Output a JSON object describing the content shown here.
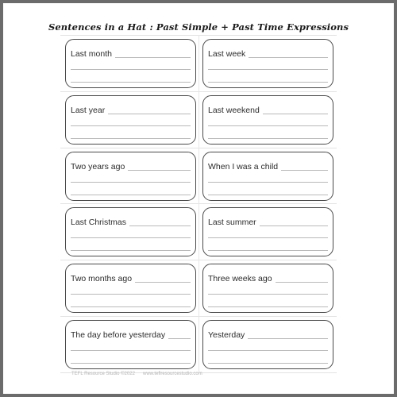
{
  "worksheet": {
    "title": "Sentences in a Hat : Past Simple + Past Time Expressions",
    "cards": [
      {
        "label": "Last month"
      },
      {
        "label": "Last week"
      },
      {
        "label": "Last year"
      },
      {
        "label": "Last weekend"
      },
      {
        "label": "Two years ago"
      },
      {
        "label": "When I was a child"
      },
      {
        "label": "Last Christmas"
      },
      {
        "label": "Last summer"
      },
      {
        "label": "Two months ago"
      },
      {
        "label": "Three weeks ago"
      },
      {
        "label": "The day before yesterday"
      },
      {
        "label": "Yesterday"
      }
    ],
    "footer": {
      "copyright": "TEFL Resource Studio ©2022",
      "website": "www.teflresourcestudio.com"
    }
  }
}
